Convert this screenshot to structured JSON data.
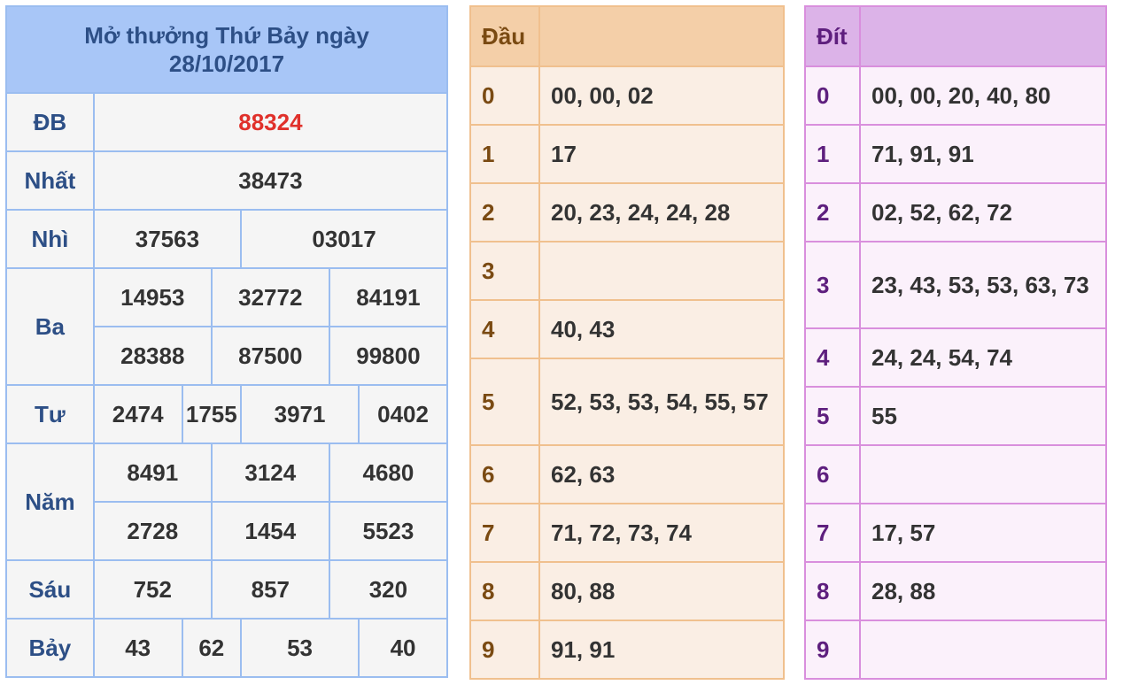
{
  "results": {
    "title_line1": "Mở thưởng Thứ Bảy ngày",
    "title_line2": "28/10/2017",
    "prizes": {
      "db": {
        "label": "ĐB",
        "values": [
          "88324"
        ]
      },
      "nhat": {
        "label": "Nhất",
        "values": [
          "38473"
        ]
      },
      "nhi": {
        "label": "Nhì",
        "values": [
          "37563",
          "03017"
        ]
      },
      "ba": {
        "label": "Ba",
        "values": [
          "14953",
          "32772",
          "84191",
          "28388",
          "87500",
          "99800"
        ]
      },
      "tu": {
        "label": "Tư",
        "values": [
          "2474",
          "1755",
          "3971",
          "0402"
        ]
      },
      "nam": {
        "label": "Năm",
        "values": [
          "8491",
          "3124",
          "4680",
          "2728",
          "1454",
          "5523"
        ]
      },
      "sau": {
        "label": "Sáu",
        "values": [
          "752",
          "857",
          "320"
        ]
      },
      "bay": {
        "label": "Bảy",
        "values": [
          "43",
          "62",
          "53",
          "40"
        ]
      }
    },
    "colors": {
      "special": "#e0312b",
      "label": "#2d4f86",
      "border": "#9bbdf0",
      "title_bg": "#a8c6f7"
    }
  },
  "dau": {
    "header": "Đầu",
    "rows": [
      {
        "digit": "0",
        "values": "00, 00, 02"
      },
      {
        "digit": "1",
        "values": "17"
      },
      {
        "digit": "2",
        "values": "20, 23, 24, 24, 28"
      },
      {
        "digit": "3",
        "values": ""
      },
      {
        "digit": "4",
        "values": "40, 43"
      },
      {
        "digit": "5",
        "values": "52, 53, 53, 54, 55, 57"
      },
      {
        "digit": "6",
        "values": "62, 63"
      },
      {
        "digit": "7",
        "values": "71, 72, 73, 74"
      },
      {
        "digit": "8",
        "values": "80, 88"
      },
      {
        "digit": "9",
        "values": "91, 91"
      }
    ]
  },
  "dit": {
    "header": "Đít",
    "rows": [
      {
        "digit": "0",
        "values": "00, 00, 20, 40, 80"
      },
      {
        "digit": "1",
        "values": "71, 91, 91"
      },
      {
        "digit": "2",
        "values": "02, 52, 62, 72"
      },
      {
        "digit": "3",
        "values": "23, 43, 53, 53, 63, 73"
      },
      {
        "digit": "4",
        "values": "24, 24, 54, 74"
      },
      {
        "digit": "5",
        "values": "55"
      },
      {
        "digit": "6",
        "values": ""
      },
      {
        "digit": "7",
        "values": "17, 57"
      },
      {
        "digit": "8",
        "values": "28, 88"
      },
      {
        "digit": "9",
        "values": ""
      }
    ]
  }
}
